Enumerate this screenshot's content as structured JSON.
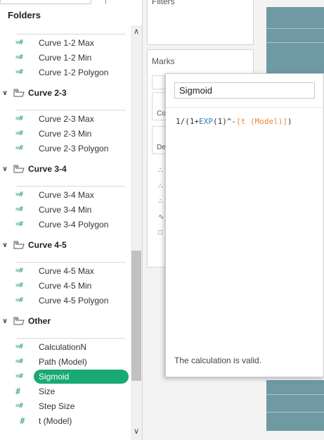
{
  "left_pane": {
    "title": "Folders",
    "groups_top": [
      {
        "label": "Curve 1-2 Max"
      },
      {
        "label": "Curve 1-2 Min"
      },
      {
        "label": "Curve 1-2 Polygon"
      }
    ],
    "folders": [
      {
        "name": "Curve 2-3",
        "items": [
          "Curve 2-3 Max",
          "Curve 2-3 Min",
          "Curve 2-3 Polygon"
        ]
      },
      {
        "name": "Curve 3-4",
        "items": [
          "Curve 3-4 Max",
          "Curve 3-4 Min",
          "Curve 3-4 Polygon"
        ]
      },
      {
        "name": "Curve 4-5",
        "items": [
          "Curve 4-5 Max",
          "Curve 4-5 Min",
          "Curve 4-5 Polygon"
        ]
      },
      {
        "name": "Other",
        "items": [
          "CalculationN",
          "Path (Model)",
          "Sigmoid",
          "Size",
          "Step Size",
          "t (Model)"
        ]
      }
    ],
    "selected_item": "Sigmoid",
    "field_icon": "calculated-field-icon",
    "param_icon": "parameter-hash-icon",
    "selected_color": "#19a974"
  },
  "shelves": {
    "filters_label": "Filters",
    "marks_label": "Marks",
    "mark_buttons": [
      "Co",
      "De"
    ]
  },
  "calc_dialog": {
    "name": "Sigmoid",
    "formula": {
      "prefix": "1/(1+",
      "func": "EXP",
      "middle": "(1)^-",
      "field": "[t (Model)]",
      "suffix": ")"
    },
    "status": "The calculation is valid."
  },
  "colors": {
    "accent": "#19a974",
    "function": "#2a7fb5",
    "field_reference": "#e8893a",
    "view_fill": "#6f99a3"
  }
}
